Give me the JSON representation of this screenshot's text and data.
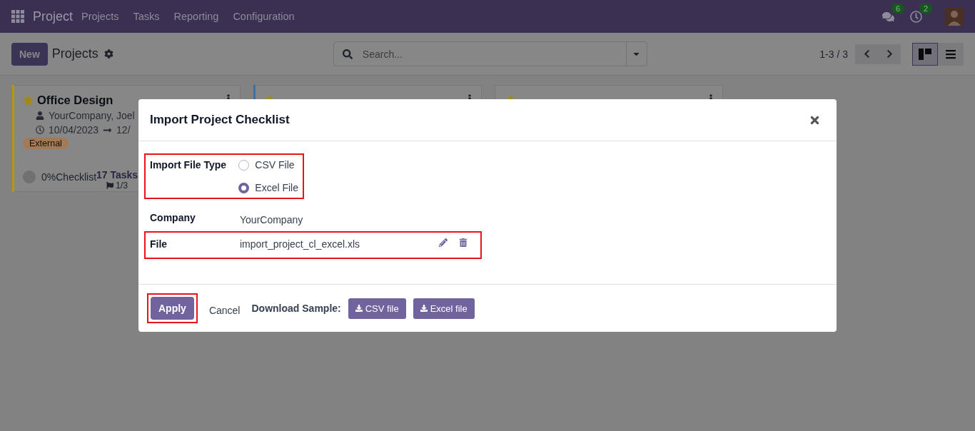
{
  "navbar": {
    "app_name": "Project",
    "menu": [
      "Projects",
      "Tasks",
      "Reporting",
      "Configuration"
    ],
    "chat_count": "6",
    "activity_count": "2"
  },
  "control_panel": {
    "new_button": "New",
    "title": "Projects",
    "search": {
      "placeholder": "Search..."
    },
    "pager": "1-3 / 3",
    "views": [
      {
        "kind": "kanban",
        "selected": true
      },
      {
        "kind": "list",
        "selected": false
      }
    ]
  },
  "cards": [
    {
      "title": "Office Design",
      "favorite": true,
      "color": "#b8960c",
      "owner": "YourCompany, Joel",
      "date_start": "10/04/2023",
      "date_end": "12/",
      "tag": "External",
      "progress": "0%",
      "checklist": "Checklist",
      "tasks": "17 Tasks",
      "milestones": "1/3"
    },
    {
      "favorite": true,
      "color": "#3e6fa6"
    },
    {
      "favorite": true
    }
  ],
  "dialog": {
    "title": "Import Project Checklist",
    "file_type": {
      "label": "Import File Type",
      "highlighted": true,
      "options": [
        {
          "label": "CSV File",
          "selected": false
        },
        {
          "label": "Excel File",
          "selected": true
        }
      ]
    },
    "company": {
      "label": "Company",
      "value": "YourCompany"
    },
    "file": {
      "label": "File",
      "value": "import_project_cl_excel.xls",
      "highlighted": true
    },
    "apply": {
      "label": "Apply",
      "highlighted": true
    },
    "cancel": "Cancel",
    "download_label": "Download Sample:",
    "sample_buttons": [
      "CSV file",
      "Excel file"
    ]
  }
}
